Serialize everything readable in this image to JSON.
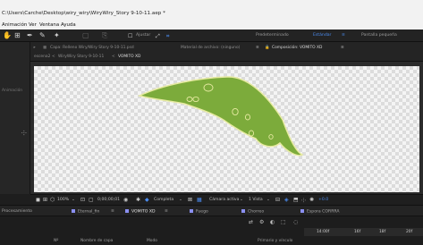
{
  "window": {
    "title": "C:\\Users\\Carche\\Desktop\\wiry_wiry\\WiryWiry_Story 9-10-11.aep *"
  },
  "menu": {
    "items": [
      "Animación",
      "Ver",
      "Ventana",
      "Ayuda"
    ]
  },
  "toolbar": {
    "snap_label": "Ajustar",
    "workspaces": [
      "Predeterminado",
      "Estándar",
      "Pantalla pequeña"
    ],
    "active_workspace": "Estándar",
    "accent": "#4b8cf0"
  },
  "left_panel": {
    "label": "Animación"
  },
  "comp_header": {
    "layer_label": "Capa: Relleno Wiry/Wiry Story 9-10-11.psd",
    "footage_label": "Material de archivo: (ninguno)",
    "composition_label": "Composición: VOMITO XD",
    "breadcrumb_1": "escena2",
    "breadcrumb_2": "WiryWiry Story 9-10-11",
    "breadcrumb_3": "VOMITO XD"
  },
  "viewer_controls": {
    "zoom": "100%",
    "timecode": "0;00;00;01",
    "resolution": "Completa",
    "camera": "Cámara activa",
    "views": "1 Vista",
    "offset": "+0.0"
  },
  "timeline": {
    "panel_label": "Procesamiento",
    "tabs": [
      {
        "label": "Eternal_fin",
        "color": "#8a8ff0"
      },
      {
        "label": "VOMITO XD",
        "color": "#8a8ff0"
      },
      {
        "label": "Fuego",
        "color": "#8a8ff0"
      },
      {
        "label": "Chorreo",
        "color": "#8a8ff0"
      },
      {
        "label": "Espora CORRRA",
        "color": "#8a8ff0"
      }
    ],
    "active_tab": "VOMITO XD",
    "ruler_labels": [
      "14:00f",
      "16f",
      "18f",
      "20f"
    ],
    "column_headers": [
      "Nº",
      "Nombre de capa",
      "Modo",
      "Primario y vínculo"
    ]
  },
  "artwork": {
    "fill": "#7cab3b",
    "stroke": "#e7eaa2",
    "dark_outline": "#3e5a1e"
  }
}
